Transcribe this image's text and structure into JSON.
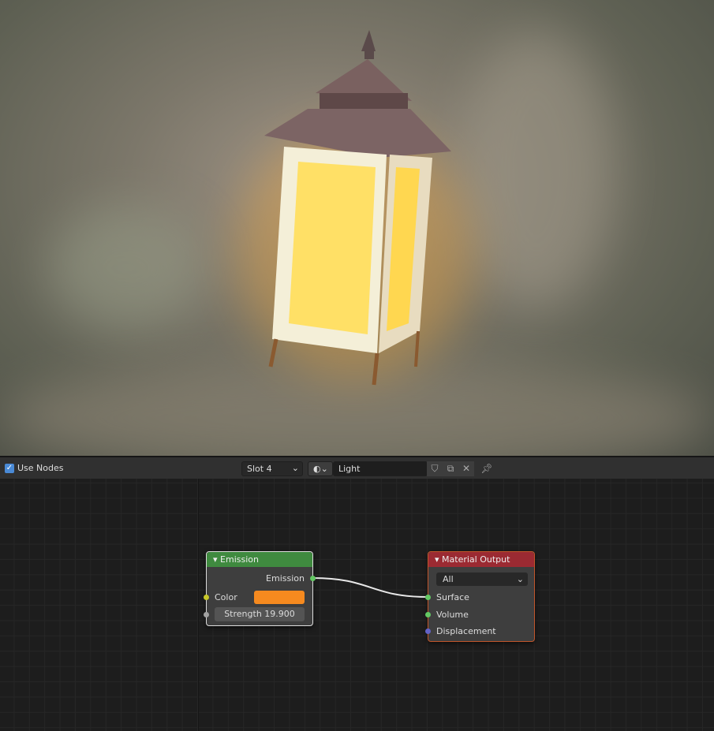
{
  "header": {
    "use_nodes_label": "Use Nodes",
    "use_nodes_checked": true,
    "slot": "Slot 4",
    "material_name": "Light"
  },
  "nodes": {
    "emission": {
      "title": "Emission",
      "output": "Emission",
      "color_label": "Color",
      "color_value": "#f68a1f",
      "strength_label": "Strength",
      "strength_value": "19.900",
      "header_color": "#3f8a3f"
    },
    "output": {
      "title": "Material Output",
      "target": "All",
      "inputs": [
        "Surface",
        "Volume",
        "Displacement"
      ],
      "header_color": "#9b2a32"
    }
  }
}
